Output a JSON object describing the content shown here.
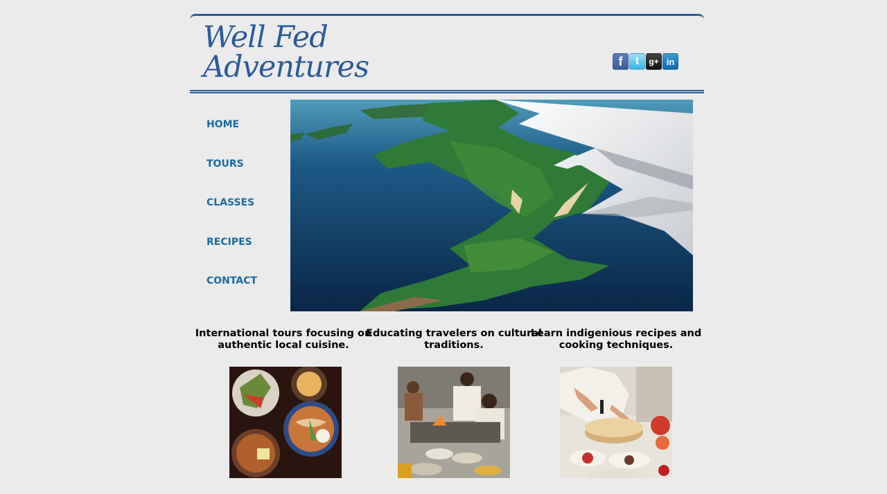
{
  "logo": {
    "line1": "Well Fed",
    "line2": "Adventures"
  },
  "social": [
    {
      "icon": "facebook-icon",
      "glyph": "f"
    },
    {
      "icon": "twitter-icon",
      "glyph": "t"
    },
    {
      "icon": "google-plus-icon",
      "glyph": "g+"
    },
    {
      "icon": "linkedin-icon",
      "glyph": "in"
    }
  ],
  "nav": {
    "items": [
      {
        "label": "HOME"
      },
      {
        "label": "TOURS"
      },
      {
        "label": "CLASSES"
      },
      {
        "label": "RECIPES"
      },
      {
        "label": "CONTACT"
      }
    ]
  },
  "features": [
    {
      "caption": "International tours focusing on authentic local cuisine."
    },
    {
      "caption": "Educating travelers on cultural traditions."
    },
    {
      "caption": "Learn indigenious recipes and cooking techniques."
    }
  ],
  "colors": {
    "brand": "#2b5b9a",
    "nav": "#1b6ba0",
    "background": "#ebebeb"
  }
}
